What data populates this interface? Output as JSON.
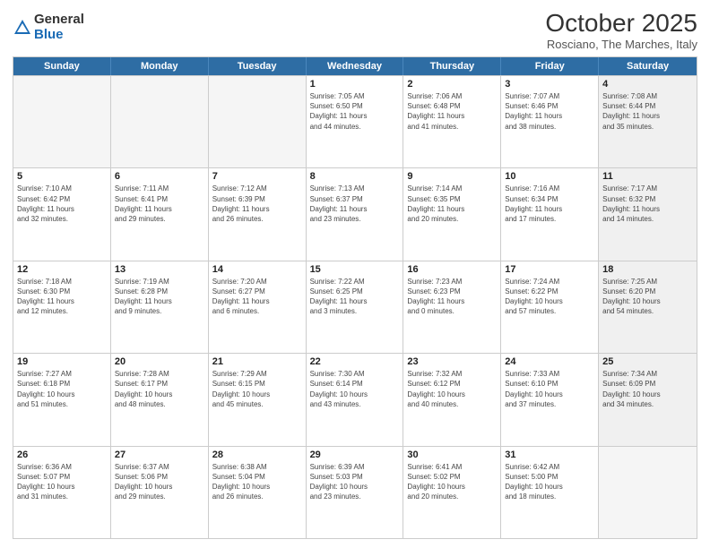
{
  "logo": {
    "general": "General",
    "blue": "Blue"
  },
  "title": "October 2025",
  "location": "Rosciano, The Marches, Italy",
  "header_days": [
    "Sunday",
    "Monday",
    "Tuesday",
    "Wednesday",
    "Thursday",
    "Friday",
    "Saturday"
  ],
  "weeks": [
    [
      {
        "day": "",
        "info": "",
        "empty": true
      },
      {
        "day": "",
        "info": "",
        "empty": true
      },
      {
        "day": "",
        "info": "",
        "empty": true
      },
      {
        "day": "1",
        "info": "Sunrise: 7:05 AM\nSunset: 6:50 PM\nDaylight: 11 hours\nand 44 minutes."
      },
      {
        "day": "2",
        "info": "Sunrise: 7:06 AM\nSunset: 6:48 PM\nDaylight: 11 hours\nand 41 minutes."
      },
      {
        "day": "3",
        "info": "Sunrise: 7:07 AM\nSunset: 6:46 PM\nDaylight: 11 hours\nand 38 minutes."
      },
      {
        "day": "4",
        "info": "Sunrise: 7:08 AM\nSunset: 6:44 PM\nDaylight: 11 hours\nand 35 minutes.",
        "shaded": true
      }
    ],
    [
      {
        "day": "5",
        "info": "Sunrise: 7:10 AM\nSunset: 6:42 PM\nDaylight: 11 hours\nand 32 minutes."
      },
      {
        "day": "6",
        "info": "Sunrise: 7:11 AM\nSunset: 6:41 PM\nDaylight: 11 hours\nand 29 minutes."
      },
      {
        "day": "7",
        "info": "Sunrise: 7:12 AM\nSunset: 6:39 PM\nDaylight: 11 hours\nand 26 minutes."
      },
      {
        "day": "8",
        "info": "Sunrise: 7:13 AM\nSunset: 6:37 PM\nDaylight: 11 hours\nand 23 minutes."
      },
      {
        "day": "9",
        "info": "Sunrise: 7:14 AM\nSunset: 6:35 PM\nDaylight: 11 hours\nand 20 minutes."
      },
      {
        "day": "10",
        "info": "Sunrise: 7:16 AM\nSunset: 6:34 PM\nDaylight: 11 hours\nand 17 minutes."
      },
      {
        "day": "11",
        "info": "Sunrise: 7:17 AM\nSunset: 6:32 PM\nDaylight: 11 hours\nand 14 minutes.",
        "shaded": true
      }
    ],
    [
      {
        "day": "12",
        "info": "Sunrise: 7:18 AM\nSunset: 6:30 PM\nDaylight: 11 hours\nand 12 minutes."
      },
      {
        "day": "13",
        "info": "Sunrise: 7:19 AM\nSunset: 6:28 PM\nDaylight: 11 hours\nand 9 minutes."
      },
      {
        "day": "14",
        "info": "Sunrise: 7:20 AM\nSunset: 6:27 PM\nDaylight: 11 hours\nand 6 minutes."
      },
      {
        "day": "15",
        "info": "Sunrise: 7:22 AM\nSunset: 6:25 PM\nDaylight: 11 hours\nand 3 minutes."
      },
      {
        "day": "16",
        "info": "Sunrise: 7:23 AM\nSunset: 6:23 PM\nDaylight: 11 hours\nand 0 minutes."
      },
      {
        "day": "17",
        "info": "Sunrise: 7:24 AM\nSunset: 6:22 PM\nDaylight: 10 hours\nand 57 minutes."
      },
      {
        "day": "18",
        "info": "Sunrise: 7:25 AM\nSunset: 6:20 PM\nDaylight: 10 hours\nand 54 minutes.",
        "shaded": true
      }
    ],
    [
      {
        "day": "19",
        "info": "Sunrise: 7:27 AM\nSunset: 6:18 PM\nDaylight: 10 hours\nand 51 minutes."
      },
      {
        "day": "20",
        "info": "Sunrise: 7:28 AM\nSunset: 6:17 PM\nDaylight: 10 hours\nand 48 minutes."
      },
      {
        "day": "21",
        "info": "Sunrise: 7:29 AM\nSunset: 6:15 PM\nDaylight: 10 hours\nand 45 minutes."
      },
      {
        "day": "22",
        "info": "Sunrise: 7:30 AM\nSunset: 6:14 PM\nDaylight: 10 hours\nand 43 minutes."
      },
      {
        "day": "23",
        "info": "Sunrise: 7:32 AM\nSunset: 6:12 PM\nDaylight: 10 hours\nand 40 minutes."
      },
      {
        "day": "24",
        "info": "Sunrise: 7:33 AM\nSunset: 6:10 PM\nDaylight: 10 hours\nand 37 minutes."
      },
      {
        "day": "25",
        "info": "Sunrise: 7:34 AM\nSunset: 6:09 PM\nDaylight: 10 hours\nand 34 minutes.",
        "shaded": true
      }
    ],
    [
      {
        "day": "26",
        "info": "Sunrise: 6:36 AM\nSunset: 5:07 PM\nDaylight: 10 hours\nand 31 minutes."
      },
      {
        "day": "27",
        "info": "Sunrise: 6:37 AM\nSunset: 5:06 PM\nDaylight: 10 hours\nand 29 minutes."
      },
      {
        "day": "28",
        "info": "Sunrise: 6:38 AM\nSunset: 5:04 PM\nDaylight: 10 hours\nand 26 minutes."
      },
      {
        "day": "29",
        "info": "Sunrise: 6:39 AM\nSunset: 5:03 PM\nDaylight: 10 hours\nand 23 minutes."
      },
      {
        "day": "30",
        "info": "Sunrise: 6:41 AM\nSunset: 5:02 PM\nDaylight: 10 hours\nand 20 minutes."
      },
      {
        "day": "31",
        "info": "Sunrise: 6:42 AM\nSunset: 5:00 PM\nDaylight: 10 hours\nand 18 minutes."
      },
      {
        "day": "",
        "info": "",
        "empty": true,
        "shaded": true
      }
    ]
  ]
}
